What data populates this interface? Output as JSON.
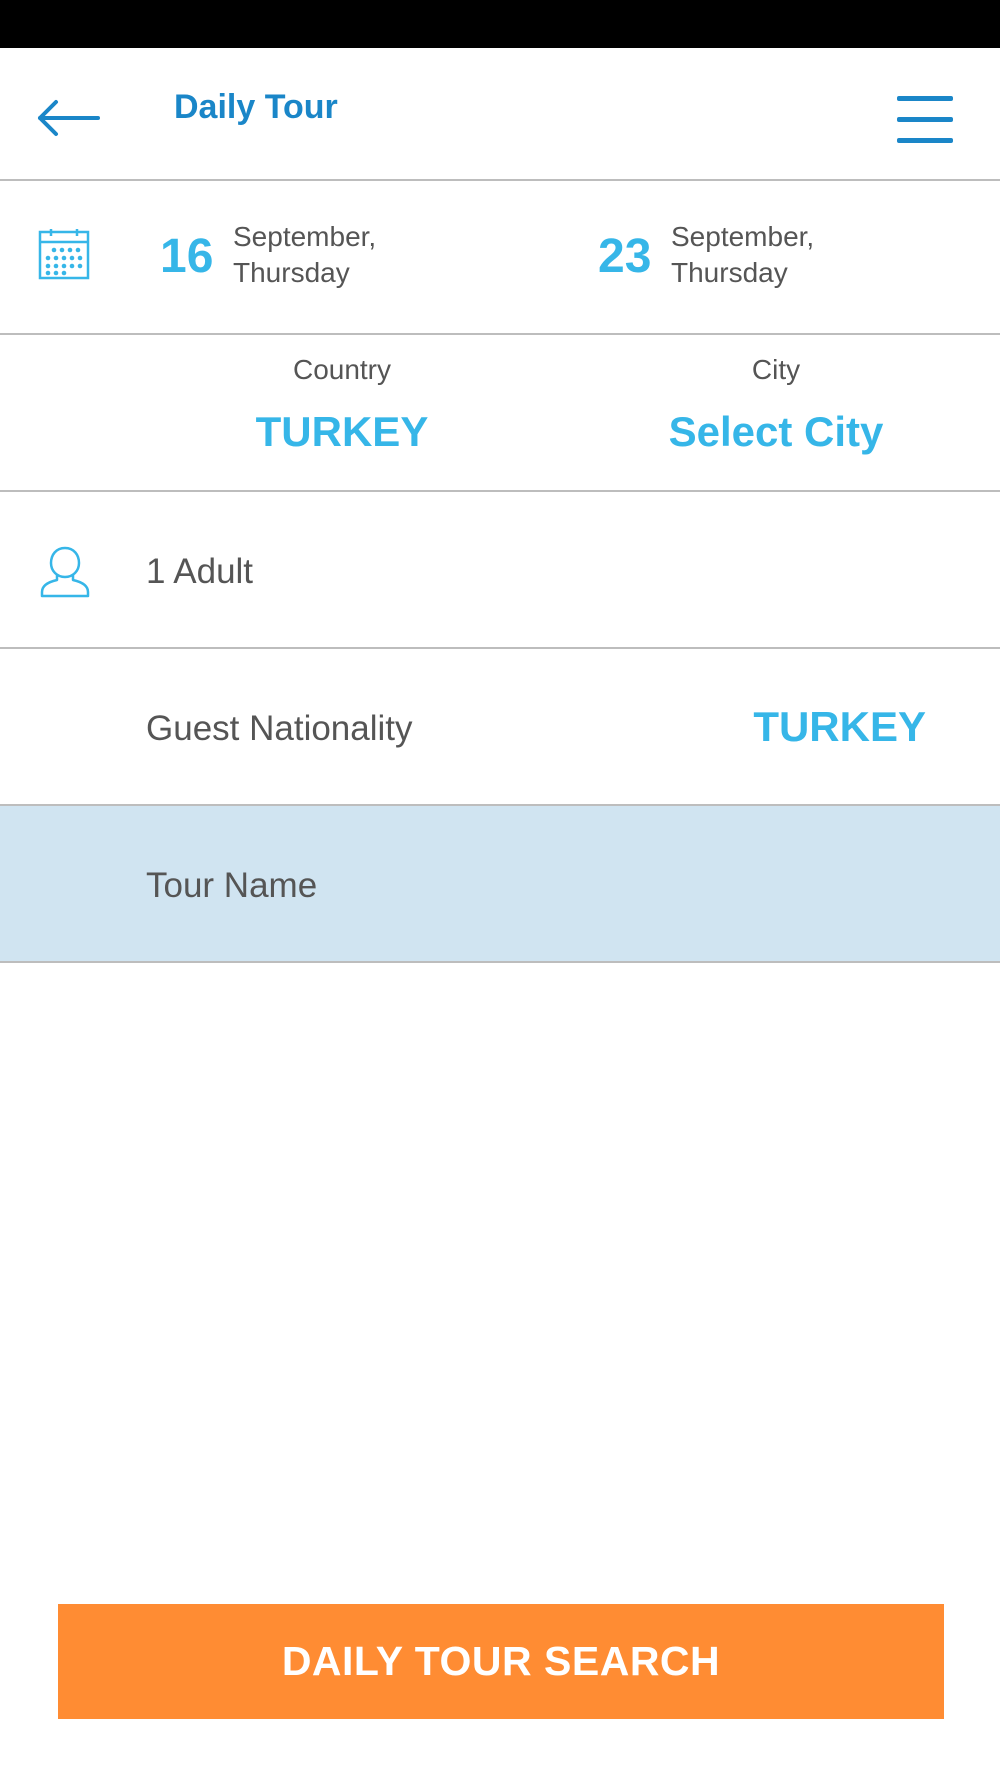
{
  "colors": {
    "header_blue": "#1a86c8",
    "accent_blue": "#36b6e8",
    "search_orange": "#ff8c33",
    "tour_row_bg": "#d0e4f1"
  },
  "header": {
    "title": "Daily Tour",
    "back_icon": "arrow-left-icon",
    "menu_icon": "hamburger-menu-icon"
  },
  "dates": {
    "icon": "calendar-icon",
    "check_in": {
      "day": "16",
      "month": "September,",
      "weekday": "Thursday"
    },
    "check_out": {
      "day": "23",
      "month": "September,",
      "weekday": "Thursday"
    }
  },
  "location": {
    "country_label": "Country",
    "country_value": "TURKEY",
    "city_label": "City",
    "city_value": "Select City"
  },
  "guests": {
    "icon": "person-icon",
    "text": "1 Adult"
  },
  "nationality": {
    "label": "Guest Nationality",
    "value": "TURKEY"
  },
  "tour_name": {
    "placeholder": "Tour Name",
    "value": ""
  },
  "search_button": {
    "label": "DAILY TOUR SEARCH"
  }
}
